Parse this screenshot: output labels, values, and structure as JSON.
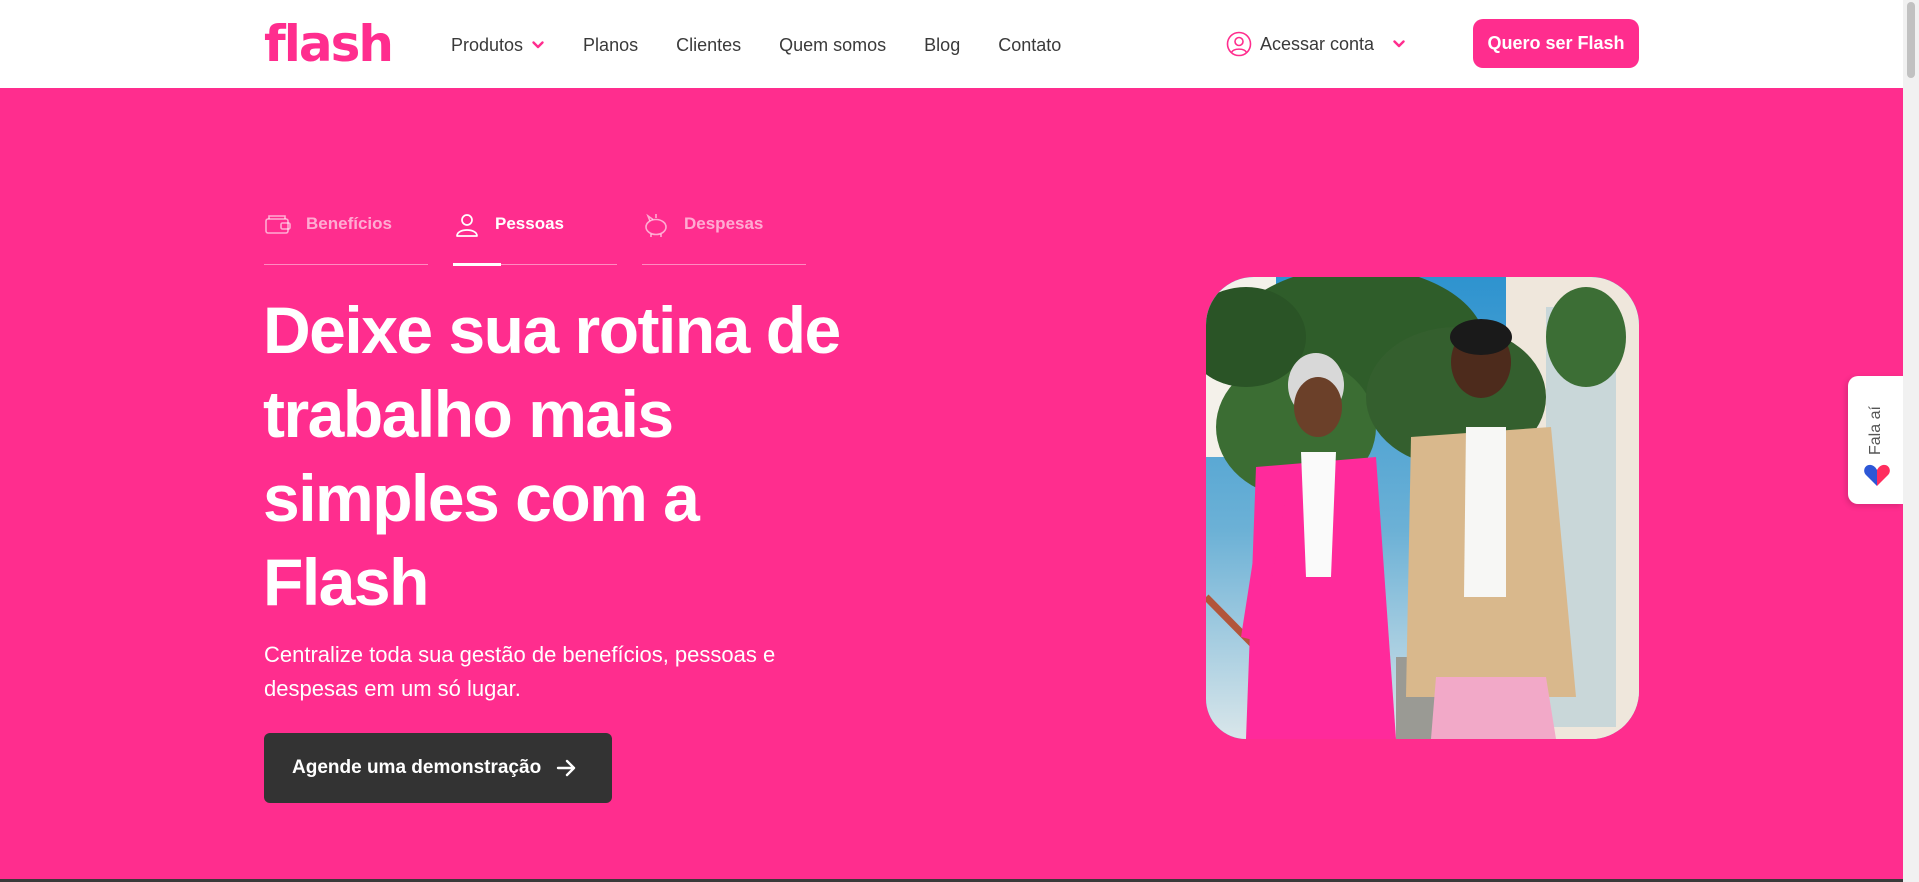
{
  "header": {
    "logo": "flash",
    "nav": [
      {
        "label": "Produtos"
      },
      {
        "label": "Planos"
      },
      {
        "label": "Clientes"
      },
      {
        "label": "Quem somos"
      },
      {
        "label": "Blog"
      },
      {
        "label": "Contato"
      }
    ],
    "account_label": "Acessar conta",
    "cta_label": "Quero ser Flash"
  },
  "hero": {
    "tabs": [
      {
        "label": "Benefícios",
        "icon": "wallet-icon",
        "active": false
      },
      {
        "label": "Pessoas",
        "icon": "user-icon",
        "active": true
      },
      {
        "label": "Despesas",
        "icon": "piggy-bank-icon",
        "active": false
      }
    ],
    "headline": "Deixe sua rotina de trabalho mais simples com a Flash",
    "subhead": "Centralize toda sua gestão de benefícios, pessoas e despesas em um só lugar.",
    "cta_label": "Agende uma demonstração"
  },
  "widget": {
    "label": "Fala aí"
  },
  "colors": {
    "brand": "#ff2d8e",
    "dark_button": "#333333",
    "text": "#3a3a3a"
  }
}
